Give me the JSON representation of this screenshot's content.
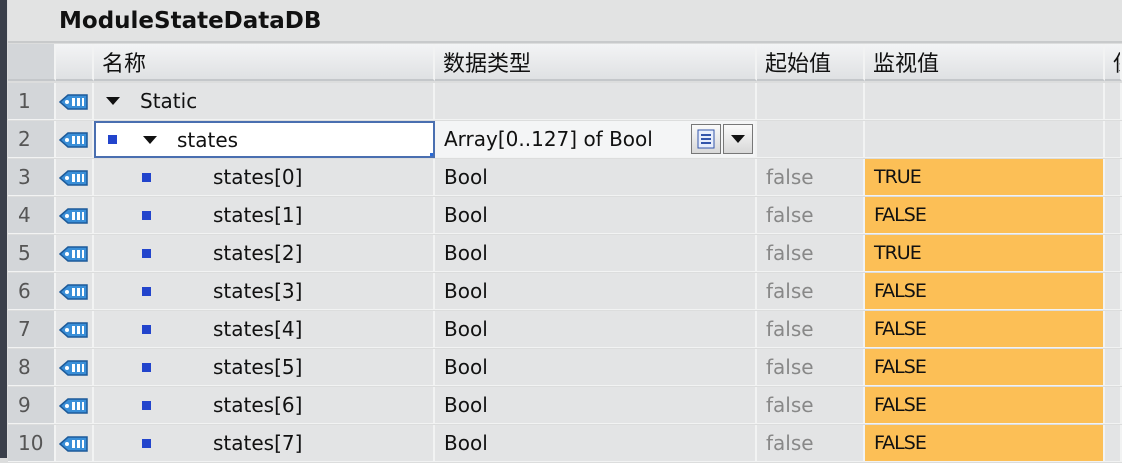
{
  "title": "ModuleStateDataDB",
  "headers": {
    "name": "名称",
    "type": "数据类型",
    "start": "起始值",
    "monitor": "监视值",
    "extra": "保"
  },
  "colors": {
    "monitor_bg": "#fcbf56",
    "selection": "#4a6fb0"
  },
  "rows": [
    {
      "num": "1",
      "name": "Static",
      "type": "",
      "start": "",
      "monitor": ""
    },
    {
      "num": "2",
      "name": "states",
      "type": "Array[0..127] of Bool",
      "start": "",
      "monitor": ""
    },
    {
      "num": "3",
      "name": "states[0]",
      "type": "Bool",
      "start": "false",
      "monitor": "TRUE"
    },
    {
      "num": "4",
      "name": "states[1]",
      "type": "Bool",
      "start": "false",
      "monitor": "FALSE"
    },
    {
      "num": "5",
      "name": "states[2]",
      "type": "Bool",
      "start": "false",
      "monitor": "TRUE"
    },
    {
      "num": "6",
      "name": "states[3]",
      "type": "Bool",
      "start": "false",
      "monitor": "FALSE"
    },
    {
      "num": "7",
      "name": "states[4]",
      "type": "Bool",
      "start": "false",
      "monitor": "FALSE"
    },
    {
      "num": "8",
      "name": "states[5]",
      "type": "Bool",
      "start": "false",
      "monitor": "FALSE"
    },
    {
      "num": "9",
      "name": "states[6]",
      "type": "Bool",
      "start": "false",
      "monitor": "FALSE"
    },
    {
      "num": "10",
      "name": "states[7]",
      "type": "Bool",
      "start": "false",
      "monitor": "FALSE"
    }
  ]
}
